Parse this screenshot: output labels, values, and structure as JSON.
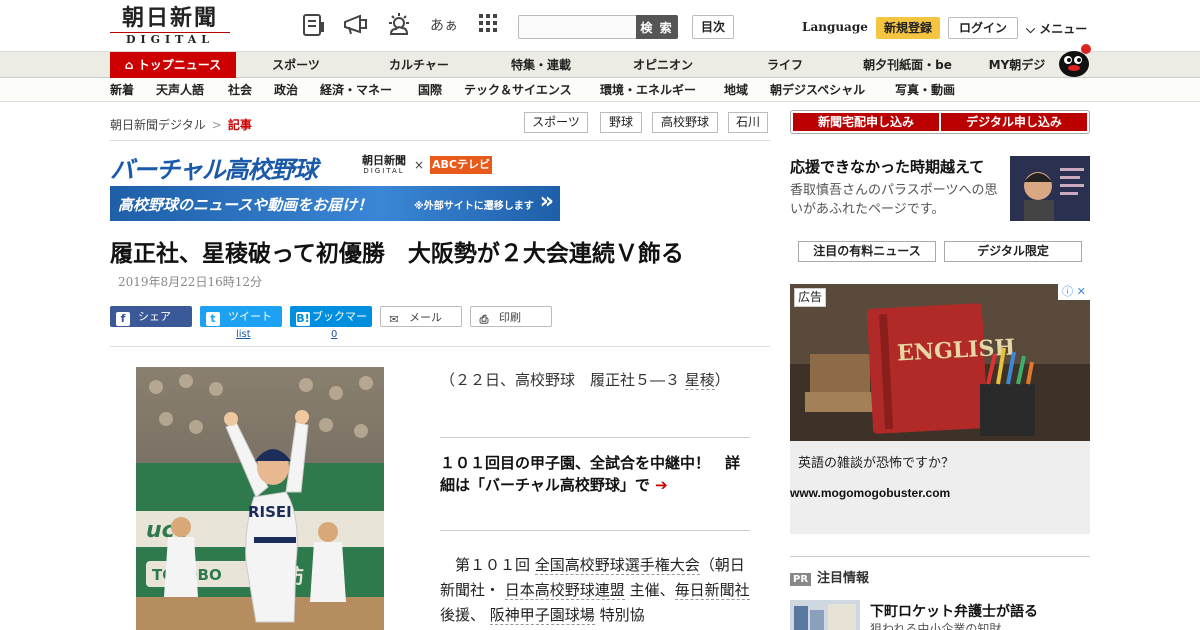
{
  "header": {
    "logo_mark": "朝日新聞",
    "logo_sub": "DIGITAL",
    "icons": [
      "news-list-icon",
      "megaphone-icon",
      "weather-icon",
      "font-size-icon",
      "apps-grid-icon"
    ],
    "font_size_glyph": "あぁ",
    "search_placeholder": "",
    "search_button": "検 索",
    "toc_button": "目次",
    "language": "Language",
    "register": "新規登録",
    "login": "ログイン",
    "menu": "メニュー"
  },
  "global_nav": {
    "items": [
      "トップニュース",
      "スポーツ",
      "カルチャー",
      "特集・連載",
      "オピニオン",
      "ライフ",
      "朝夕刊紙面・be",
      "MY朝デジ"
    ]
  },
  "sub_nav": {
    "items": [
      "新着",
      "天声人語",
      "社会",
      "政治",
      "経済・マネー",
      "国際",
      "テック＆サイエンス",
      "環境・エネルギー",
      "地域",
      "朝デジスペシャル",
      "写真・動画"
    ]
  },
  "breadcrumb": {
    "home": "朝日新聞デジタル",
    "sep": ">",
    "current": "記事"
  },
  "tags": [
    "スポーツ",
    "野球",
    "高校野球",
    "石川"
  ],
  "virtual_koshien": {
    "title": "バーチャル高校野球",
    "asahi_line1": "朝日新聞",
    "asahi_line2": "DIGITAL",
    "times": "×",
    "abc": "ABCテレビ",
    "banner_main": "高校野球のニュースや動画をお届け！",
    "banner_note": "※外部サイトに遷移します"
  },
  "article": {
    "headline": "履正社、星稜破って初優勝　大阪勢が２大会連続Ｖ飾る",
    "date": "2019年8月22日16時12分",
    "caption_pre": "（２２日、高校野球　履正社５―３ ",
    "caption_link": "星稜",
    "caption_post": "）",
    "promo": "１０１回目の甲子園、全試合を中継中！　詳細は「バーチャル高校野球」で",
    "body_indent": "第１０１回 ",
    "body_link1": "全国高校野球選手権大会",
    "body_mid1": "（朝日新聞社・ ",
    "body_link2": "日本高校野球連盟",
    "body_mid2": " 主催、",
    "body_link3": "毎日新聞社",
    "body_mid3": " 後援、 ",
    "body_link4": "阪神甲子園球場",
    "body_mid4": " 特別協"
  },
  "share": {
    "facebook": "シェア",
    "twitter": "ツイート",
    "twitter_count": "list",
    "hatena": "ブックマーク",
    "hatena_count": "0",
    "mail": "メール",
    "print": "印刷"
  },
  "photo": {
    "jersey": "RISEI",
    "sign1": "TOYOBO",
    "sign2": "詳紡"
  },
  "right": {
    "subscribe_paper": "新聞宅配申し込み",
    "subscribe_digital": "デジタル申し込み",
    "feature_title": "応援できなかった時期越えて",
    "feature_desc": "香取慎吾さんのパラスポーツへの思いがあふれたページです。",
    "tab_paid": "注目の有料ニュース",
    "tab_digital": "デジタル限定",
    "ad_label": "広告",
    "ad_book_text": "ENGLISH",
    "ad_question": "英語の雑談が恐怖ですか？",
    "ad_url": "www.mogomogobuster.com",
    "pr_badge": "PR",
    "pr_title": "注目情報",
    "pr_item_head": "下町ロケット弁護士が語る",
    "pr_item_sub": "狙われる中小企業の知財"
  },
  "colors": {
    "brand_red": "#c00000",
    "register_yellow": "#f5c542",
    "facebook": "#3b5998",
    "twitter": "#1da1f2",
    "hatena": "#008fde",
    "virtual_blue": "#1a5aa8"
  }
}
